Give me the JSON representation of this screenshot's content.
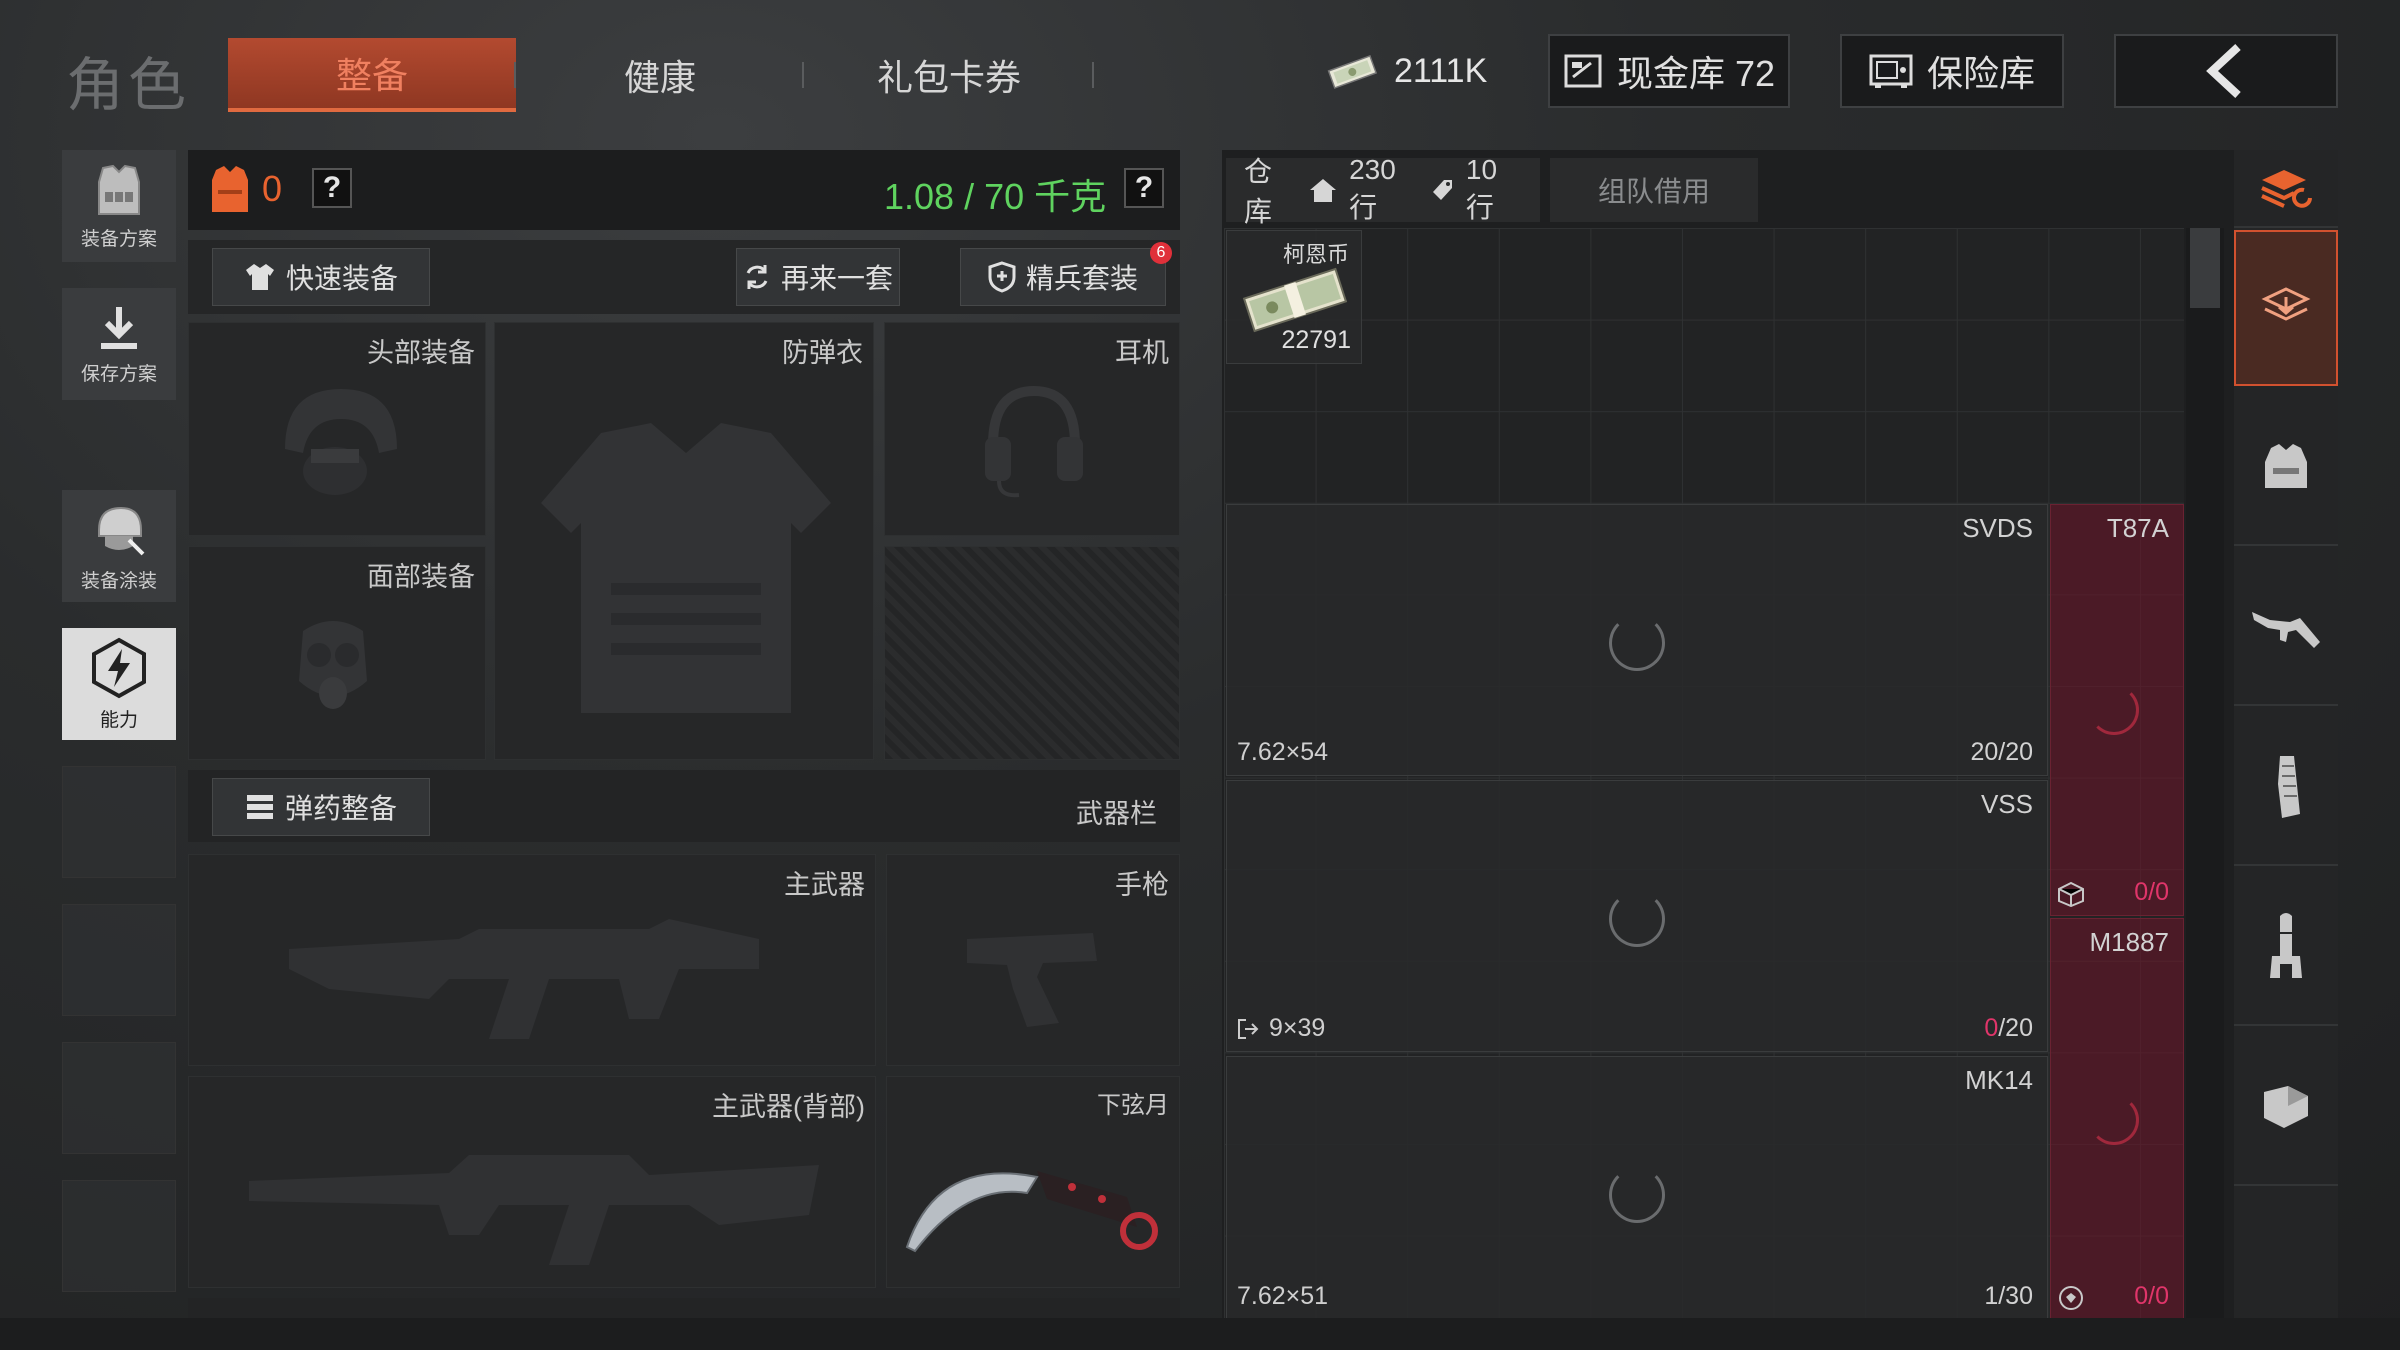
{
  "header": {
    "page_title": "角色",
    "tabs": [
      {
        "label": "整备",
        "active": true
      },
      {
        "label": "健康",
        "active": false
      },
      {
        "label": "礼包卡券",
        "active": false
      }
    ],
    "currency_amount": "2111K",
    "cash_vault_label": "现金库 72",
    "safe_label": "保险库",
    "back_icon": "chevron-left-icon"
  },
  "sidebar": {
    "items": [
      {
        "label": "装备方案",
        "icon": "vest-loadout-icon"
      },
      {
        "label": "保存方案",
        "icon": "download-icon"
      },
      {
        "label": "装备涂装",
        "icon": "helmet-paint-icon"
      },
      {
        "label": "能力",
        "icon": "lightning-hexagon-icon",
        "active": true
      }
    ]
  },
  "equipment": {
    "armor_count": "0",
    "weight": "1.08 / 70 千克",
    "quick_equip_label": "快速装备",
    "another_set_label": "再来一套",
    "elite_set_label": "精兵套装",
    "elite_badge": "6",
    "slots": {
      "head": "头部装备",
      "vest": "防弹衣",
      "headset": "耳机",
      "face": "面部装备"
    },
    "ammo_label": "弹药整备",
    "weapon_bar_label": "武器栏",
    "weapon_slots": {
      "primary": "主武器",
      "pistol": "手枪",
      "primary_back": "主武器(背部)",
      "melee": "下弦月"
    }
  },
  "stash": {
    "warehouse_label": "仓库",
    "rows_label": "230行",
    "tag_rows_label": "10行",
    "team_borrow_label": "组队借用",
    "coin": {
      "name": "柯恩币",
      "count": "22791"
    },
    "weapons": [
      {
        "name": "SVDS",
        "caliber": "7.62×54",
        "ammo": "20/20"
      },
      {
        "name": "VSS",
        "caliber": "9×39",
        "ammo_current": "0",
        "ammo_total": "/20"
      },
      {
        "name": "MK14",
        "caliber": "7.62×51",
        "ammo": "1/30"
      }
    ],
    "side_weapons": [
      {
        "name": "T87A",
        "ammo_current": "0",
        "ammo_total": "/0"
      },
      {
        "name": "M1887",
        "ammo_current": "0",
        "ammo_total": "/0"
      }
    ]
  },
  "rail_icons": [
    "stack-refresh-icon",
    "stack-active-icon",
    "vest-icon",
    "rifle-icon",
    "magazine-icon",
    "bullet-icon",
    "armor-plate-icon"
  ],
  "colors": {
    "accent": "#d2512f",
    "weight_green": "#5fd35f",
    "warning_pink": "#e0356a"
  }
}
